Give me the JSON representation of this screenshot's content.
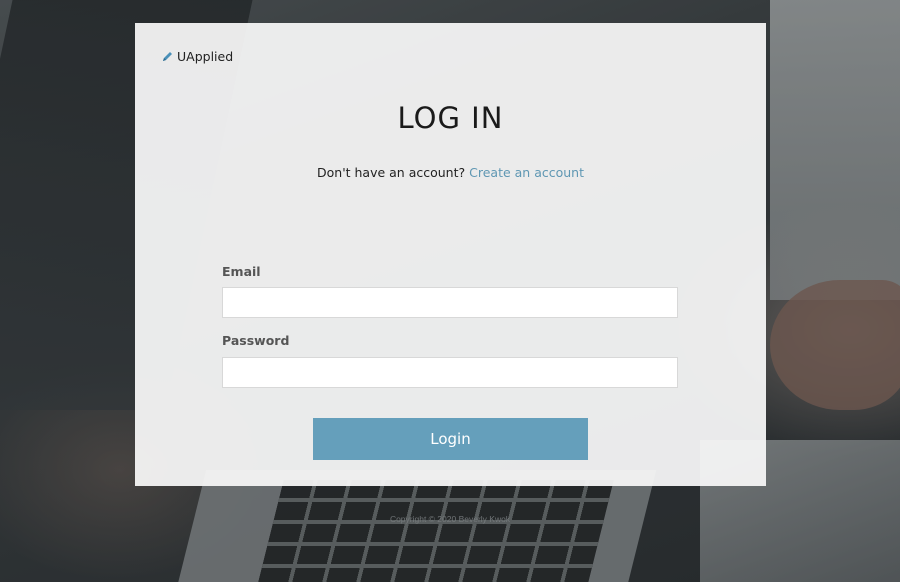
{
  "brand": {
    "name": "UApplied",
    "icon": "pencil-icon",
    "icon_color": "#4a90b8"
  },
  "login_form": {
    "title": "LOG IN",
    "signup_prompt": "Don't have an account?",
    "signup_link": "Create an account",
    "email_label": "Email",
    "email_value": "",
    "password_label": "Password",
    "password_value": "",
    "submit_label": "Login"
  },
  "footer": {
    "copyright": "Copyright © 2020 Beverly Kwok"
  },
  "colors": {
    "accent": "#659fbb",
    "link": "#5f97b3",
    "card_background": "#f6f6f7"
  }
}
